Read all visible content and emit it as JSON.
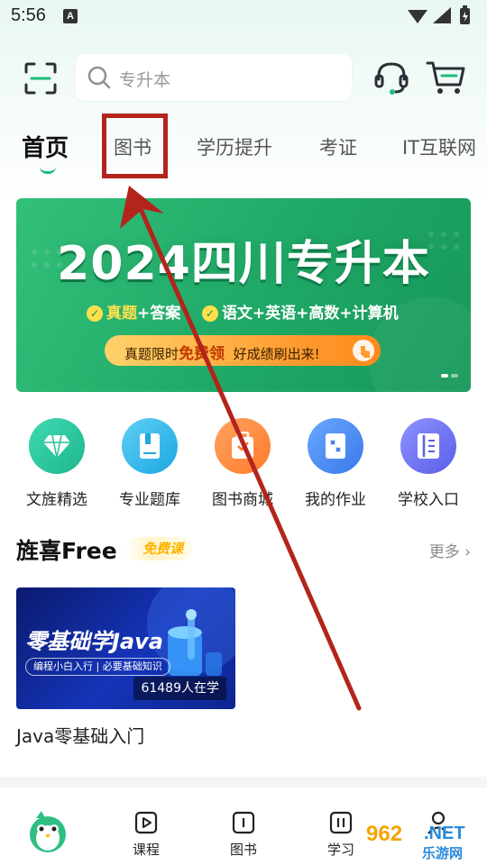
{
  "status_bar": {
    "time": "5:56",
    "notification_badge": "A"
  },
  "header": {
    "scan_icon": "scan-icon",
    "search_placeholder": "专升本",
    "service_icon": "headset-icon",
    "cart_icon": "cart-icon"
  },
  "tabs": [
    {
      "label": "首页",
      "active": true
    },
    {
      "label": "图书",
      "active": false,
      "highlighted": true
    },
    {
      "label": "学历提升",
      "active": false
    },
    {
      "label": "考证",
      "active": false
    },
    {
      "label": "IT互联网",
      "active": false
    }
  ],
  "banner": {
    "title": "2024四川专升本",
    "line2_part1_hl": "真题",
    "line2_part1": "+答案",
    "line2_part2": "语文+英语+高数+计算机",
    "pill_text_1": "真题限时",
    "pill_text_hl": "免费领",
    "pill_text_2": "好成绩刷出来!"
  },
  "quick_links": [
    {
      "label": "文旌精选",
      "icon": "diamond-icon",
      "color": "#27c6a0"
    },
    {
      "label": "专业题库",
      "icon": "book-icon",
      "color": "#2fb7e8"
    },
    {
      "label": "图书商城",
      "icon": "bookstore-icon",
      "color": "#ff8a3d"
    },
    {
      "label": "我的作业",
      "icon": "homework-icon",
      "color": "#4a8df0"
    },
    {
      "label": "学校入口",
      "icon": "school-icon",
      "color": "#6a6ef0"
    }
  ],
  "free_section": {
    "title": "旌喜Free",
    "badge": "免费课",
    "more": "更多",
    "course": {
      "cover_title": "零基础学Java",
      "cover_sub": "编程小白入行 | 必要基础知识",
      "learners": "61489人在学",
      "name": "Java零基础入门"
    }
  },
  "bottom_nav": [
    {
      "label": "",
      "icon": "mascot-icon"
    },
    {
      "label": "课程",
      "icon": "play-icon"
    },
    {
      "label": "图书",
      "icon": "book-open-icon"
    },
    {
      "label": "学习",
      "icon": "pause-icon"
    },
    {
      "label": "",
      "icon": "profile-icon"
    }
  ],
  "watermark": {
    "number": "962",
    "domain": ".NET",
    "text": "乐游网"
  },
  "colors": {
    "accent_green": "#1dbd7b",
    "highlight_red": "#b3241c",
    "banner_green": "#1fa866"
  }
}
